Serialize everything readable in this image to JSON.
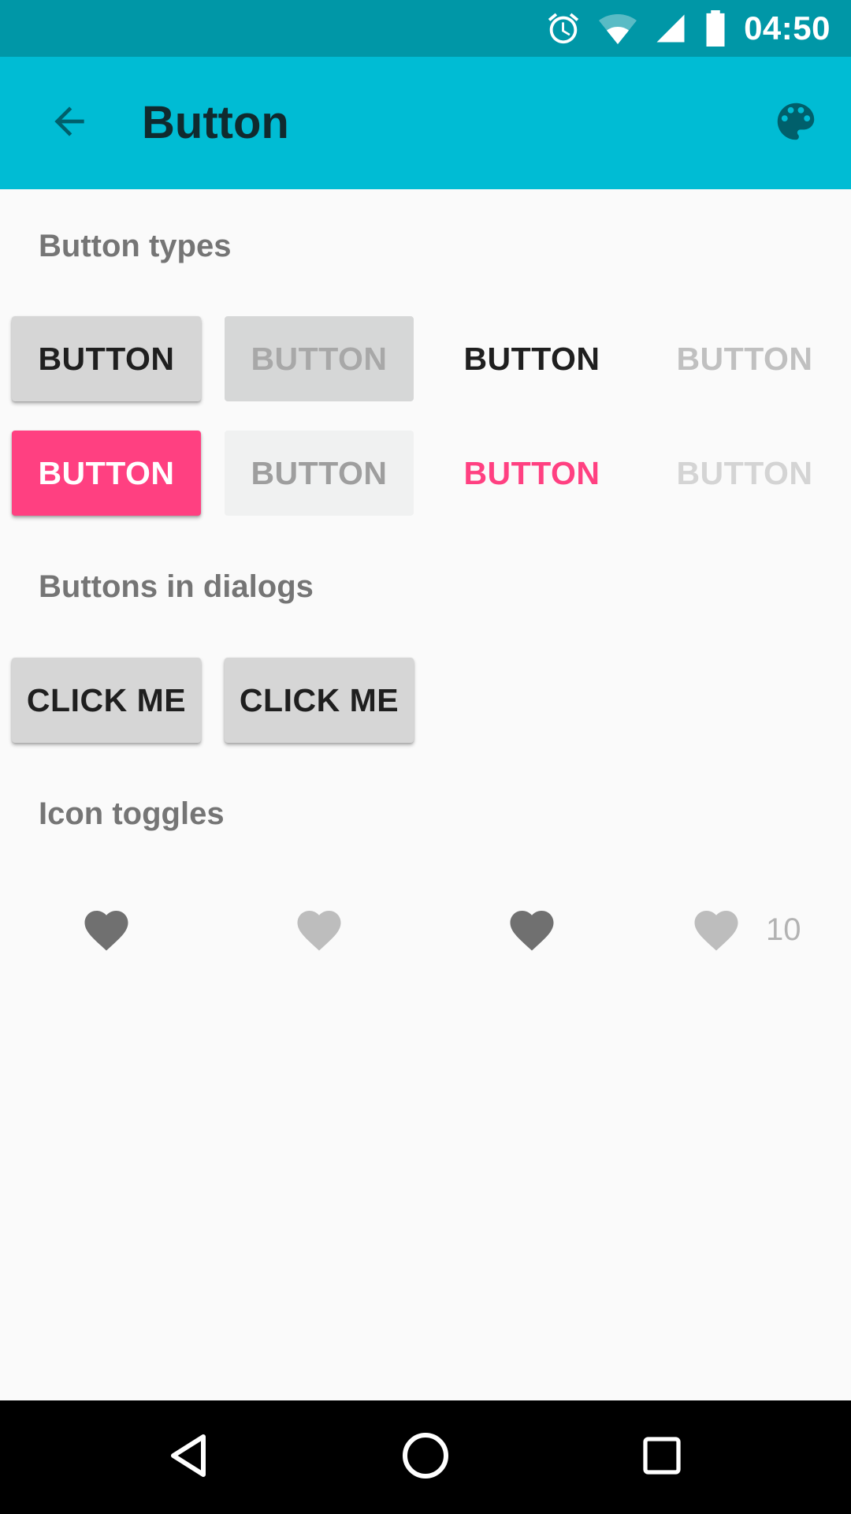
{
  "status_bar": {
    "time": "04:50",
    "icons": [
      "alarm-icon",
      "wifi-icon",
      "cell-signal-icon",
      "battery-icon"
    ]
  },
  "toolbar": {
    "title": "Button",
    "back_icon": "arrow-back-icon",
    "palette_icon": "palette-icon"
  },
  "sections": {
    "button_types": "Button types",
    "buttons_in_dialogs": "Buttons in dialogs",
    "icon_toggles": "Icon toggles"
  },
  "button_types": {
    "row1": [
      {
        "label": "BUTTON",
        "style": "raised",
        "enabled": true
      },
      {
        "label": "BUTTON",
        "style": "raised",
        "enabled": false
      },
      {
        "label": "BUTTON",
        "style": "flat",
        "enabled": true
      },
      {
        "label": "BUTTON",
        "style": "flat",
        "enabled": false
      }
    ],
    "row2": [
      {
        "label": "BUTTON",
        "style": "colored",
        "enabled": true
      },
      {
        "label": "BUTTON",
        "style": "colored",
        "enabled": false
      },
      {
        "label": "BUTTON",
        "style": "flat-colored",
        "enabled": true
      },
      {
        "label": "BUTTON",
        "style": "flat-colored",
        "enabled": false
      }
    ]
  },
  "dialog_buttons": [
    {
      "label": "CLICK ME"
    },
    {
      "label": "CLICK ME"
    }
  ],
  "icon_toggles": [
    {
      "icon": "heart-icon",
      "checked": true,
      "enabled": true
    },
    {
      "icon": "heart-icon",
      "checked": false,
      "enabled": false
    },
    {
      "icon": "heart-icon",
      "checked": true,
      "enabled": true
    },
    {
      "icon": "heart-icon",
      "checked": false,
      "enabled": true,
      "count": "10"
    }
  ],
  "nav_bar": {
    "icons": [
      "back-triangle-icon",
      "home-circle-icon",
      "recents-square-icon"
    ]
  },
  "colors": {
    "status_bar": "#0097a7",
    "toolbar": "#00bcd4",
    "accent": "#ff4081",
    "background": "#fafafa",
    "toolbar_icon": "#005f6b"
  }
}
